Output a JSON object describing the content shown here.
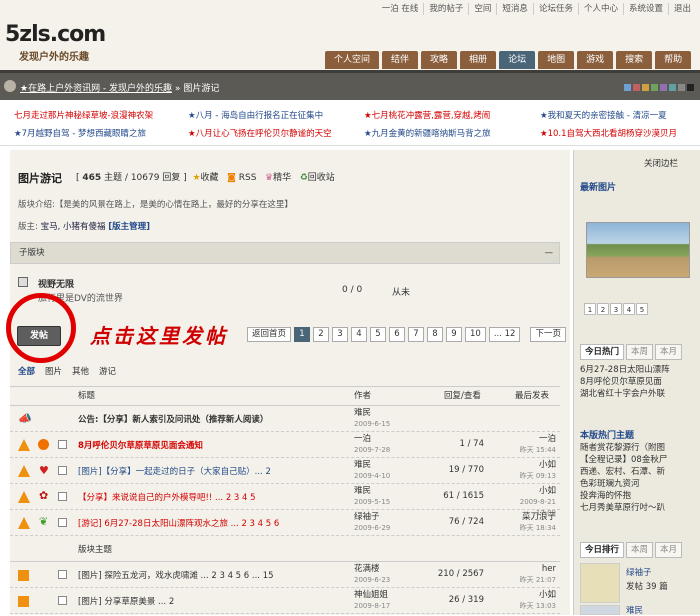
{
  "header": {
    "logo_main": "5zls.com",
    "logo_slogan": "发现户外的乐趣",
    "topnav": [
      "一泊 在线",
      "我的帖子",
      "空间",
      "短消息",
      "论坛任务",
      "个人中心",
      "系统设置",
      "退出"
    ],
    "tabs": [
      "个人空间",
      "结伴",
      "攻略",
      "相册",
      "论坛",
      "地图",
      "游戏",
      "搜索",
      "帮助"
    ],
    "active_tab": "论坛"
  },
  "breadcrumb": {
    "items": [
      "★在路上户外资讯网 - 发现户外的乐趣",
      "图片游记"
    ],
    "separator": "»"
  },
  "announcements": [
    "七月走过那片神秘绿草坡-浪漫神农架",
    "★八月 - 海岛自由行报名正在征集中",
    "★七月桃花冲露营,露营,穿越,烤闹",
    "★我和夏天的亲密接触 - 清凉一夏",
    "★7月越野自驾 - 梦想西藏眼睛之旅",
    "★八月让心飞扬在呼伦贝尔静谧的天空",
    "★九月金黄的新疆喀纳斯马背之旅",
    "★10.1自驾大西北看胡杨穿沙漠贝月"
  ],
  "forum": {
    "title": "图片游记",
    "threads_count": "465",
    "threads_label": "主题",
    "replies_count": "10679",
    "replies_label": "回复",
    "favorite": "收藏",
    "rss": "RSS",
    "digest": "精华",
    "recycle": "回收站",
    "intro": "版块介绍:【是美的风景在路上，是美的心情在路上，最好的分享在这里】",
    "moderators_label": "版主:",
    "moderators": "宝马, 小猪有傻福",
    "manage": "[版主管理]"
  },
  "subforum": {
    "header": "子版块",
    "collapse": "—",
    "name": "视野无限",
    "desc": "旅行里是DV的流世界",
    "stats": "0 / 0",
    "last": "从未"
  },
  "post_button": "发帖",
  "annotation": "点击这里发帖",
  "pager": {
    "back": "返回首页",
    "pages": [
      "1",
      "2",
      "3",
      "4",
      "5",
      "6",
      "7",
      "8",
      "9",
      "10",
      "... 12"
    ],
    "current": "1",
    "next": "下一页"
  },
  "filters": [
    "全部",
    "图片",
    "其他",
    "游记"
  ],
  "active_filter": "全部",
  "table_head": {
    "title": "标题",
    "author": "作者",
    "replies_views": "回复/查看",
    "last_post": "最后发表"
  },
  "threads": [
    {
      "title": "公告:【分享】新人索引及问讯处（推荐新人阅读）",
      "author": "难民",
      "date": "2009-6-15",
      "stats": "",
      "last": "",
      "last_time": "",
      "color": "#222"
    },
    {
      "title": "8月呼伦贝尔草原草原见面会通知",
      "author": "一泊",
      "date": "2009-7-28",
      "stats": "1 / 74",
      "last": "一泊",
      "last_time": "昨天 15:44",
      "color": "#d40000"
    },
    {
      "title": "[图片]【分享】一起走过的日子（大家自己贴）... 2",
      "author": "难民",
      "date": "2009-4-10",
      "stats": "19 / 770",
      "last": "小如",
      "last_time": "昨天 09:13",
      "color": "#234a8a"
    },
    {
      "title": "【分享】来说说自己的户外模导吧!! ... 2 3 4 5",
      "author": "难民",
      "date": "2009-5-15",
      "stats": "61 / 1615",
      "last": "小如",
      "last_time": "2009-8-21 17:09",
      "color": "#d40000"
    },
    {
      "title": "[游记] 6月27-28日太阳山漂阵观水之旅 ... 2 3 4 5 6",
      "author": "绿袖子",
      "date": "2009-6-29",
      "stats": "76 / 724",
      "last": "菜刀浪子",
      "last_time": "昨天 18:34",
      "color": "#d40000"
    },
    {
      "title": "版块主题",
      "author": "",
      "date": "",
      "stats": "",
      "last": "",
      "last_time": "",
      "color": "#333"
    },
    {
      "title": "[图片] 探险五龙河，戏水虎啸滩 ... 2 3 4 5 6 ... 15",
      "author": "花满楼",
      "date": "2009-6-23",
      "stats": "210 / 2567",
      "last": "her",
      "last_time": "昨天 21:07",
      "color": "#333"
    },
    {
      "title": "[图片] 分享草原美景 ... 2",
      "author": "神仙姐姐",
      "date": "2009-8-17",
      "stats": "26 / 319",
      "last": "小如",
      "last_time": "昨天 13:03",
      "color": "#333"
    }
  ],
  "sidebar": {
    "close": "关闭边栏",
    "latest_photo": "最新图片",
    "photo_pages": [
      "1",
      "2",
      "3",
      "4",
      "5"
    ],
    "hot_tabs": [
      "今日热门",
      "本周",
      "本月"
    ],
    "hot_list": [
      "6月27-28日太阳山漂阵",
      "8月呼伦贝尔草原见面",
      "湖北省红十字会户外联"
    ],
    "new_hot_title": "本版热门主题",
    "new_hot_list": [
      "随者赏花黎源行（附图",
      "【全程记录】08金秋尸",
      "西递、宏村、石潭、新",
      "色彩斑斓九资河",
      "投奔海的怀抱",
      "七月秀美草原行吋～趴"
    ],
    "rank_tabs": [
      "今日排行",
      "本周",
      "本月"
    ],
    "rank_user": "绿袖子",
    "rank_posts_label": "发帖",
    "rank_posts": "39 篇",
    "rank_user2": "难民"
  }
}
